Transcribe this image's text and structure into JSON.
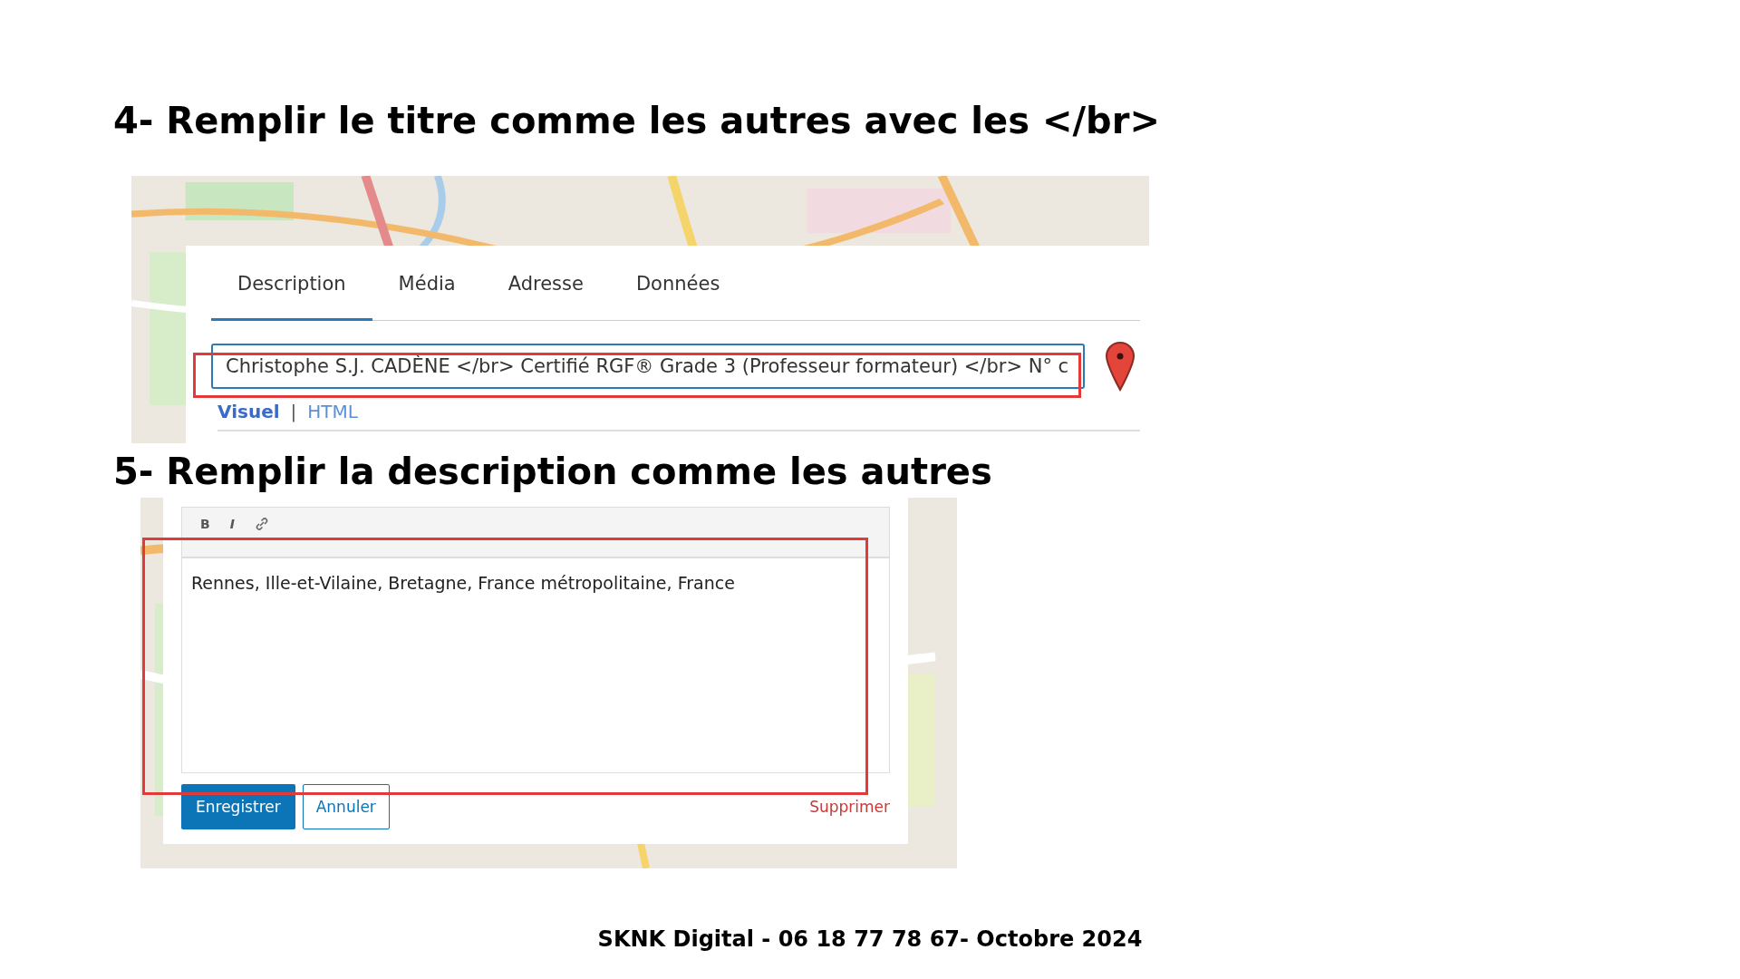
{
  "steps": [
    {
      "heading": "4- Remplir le titre comme les autres avec les </br>",
      "screen": {
        "kind": "title",
        "tabs": [
          {
            "label": "Description",
            "selected": true
          },
          {
            "label": "Média",
            "selected": false
          },
          {
            "label": "Adresse",
            "selected": false
          },
          {
            "label": "Données",
            "selected": false
          }
        ],
        "title_field": {
          "value": "Christophe S.J. CADÈNE </br> Certifié RGF® Grade 3 (Professeur formateur) </br> N° c"
        },
        "modes": [
          {
            "label": "Visuel",
            "selected": true
          },
          {
            "label": "HTML",
            "selected": false
          }
        ],
        "mode_separator": "|"
      }
    },
    {
      "heading": "5- Remplir la description comme les autres",
      "screen": {
        "kind": "description",
        "toolbar": [
          "B",
          "I"
        ],
        "editor_text": "Rennes, Ille-et-Vilaine, Bretagne, France métropolitaine, France",
        "save_button": "Enregistrer",
        "cancel_button": "Annuler",
        "delete_link": "Supprimer"
      }
    }
  ],
  "footer": "SKNK Digital - 06 18 77 78 67- Octobre 2024"
}
